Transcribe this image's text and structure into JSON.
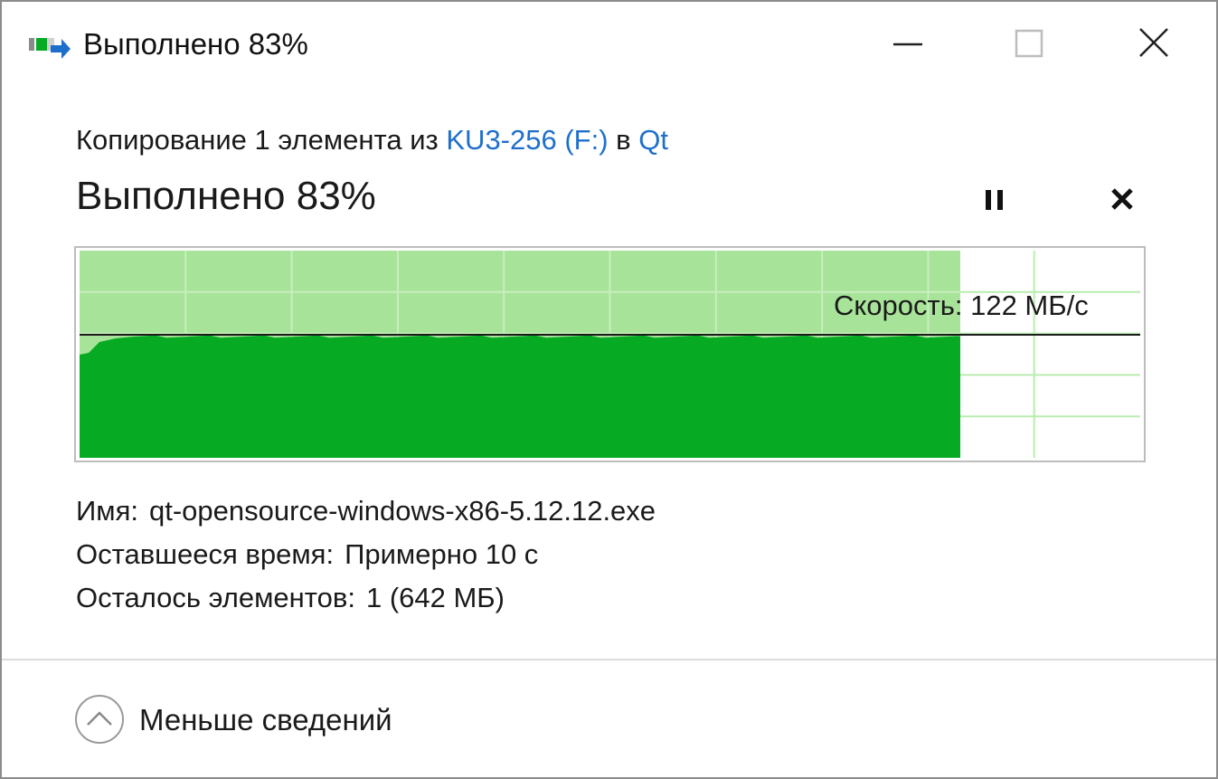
{
  "window": {
    "title": "Выполнено 83%",
    "icon": "copy-transfer-icon"
  },
  "progress": {
    "copying_prefix": "Копирование 1 элемента из ",
    "source": "KU3-256 (F:)",
    "middle": " в ",
    "destination": "Qt",
    "heading": "Выполнено 83%",
    "percent": 83,
    "pause_icon": "pause-icon",
    "cancel_icon": "close-icon"
  },
  "graph": {
    "speed_label": "Скорость: 122 МБ/с",
    "fill_fraction": 0.83,
    "colors": {
      "light": "#a8e39a",
      "dark": "#06ab23",
      "grid": "#b9ecb0"
    }
  },
  "details": {
    "name_label": "Имя:",
    "name_value": "qt-opensource-windows-x86-5.12.12.exe",
    "time_label": "Оставшееся время:",
    "time_value": "Примерно 10 с",
    "items_label": "Осталось элементов:",
    "items_value": "1 (642 МБ)"
  },
  "footer": {
    "less_details": "Меньше сведений",
    "less_icon": "chevron-up-icon"
  }
}
